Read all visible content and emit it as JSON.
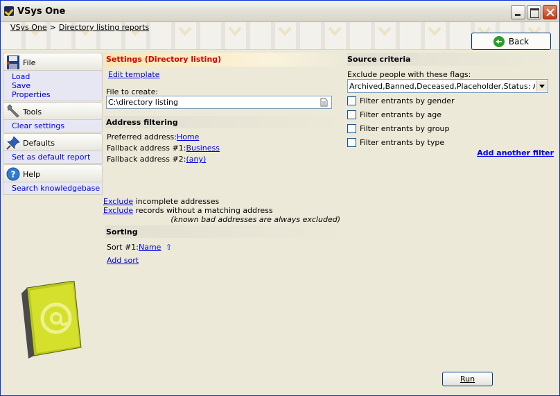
{
  "window": {
    "title": "VSys One"
  },
  "breadcrumb": {
    "root": "VSys One",
    "separator": ">",
    "current": "Directory listing reports"
  },
  "back_button": {
    "label": "Back"
  },
  "sidebar": {
    "sections": [
      {
        "title": "File",
        "icon": "floppy-disk-icon",
        "items": [
          "Load",
          "Save",
          "Properties"
        ]
      },
      {
        "title": "Tools",
        "icon": "wrench-icon",
        "items": [
          "Clear settings"
        ]
      },
      {
        "title": "Defaults",
        "icon": "pushpin-icon",
        "items": [
          "Set as default report"
        ]
      },
      {
        "title": "Help",
        "icon": "help-icon",
        "items": [
          "Search knowledgebase"
        ]
      }
    ]
  },
  "settings": {
    "title": "Settings (Directory listing)",
    "edit_template": "Edit template",
    "file_label": "File to create:",
    "file_value": "C:\\directory listing"
  },
  "address_filtering": {
    "title": "Address filtering",
    "preferred_label": "Preferred address:",
    "preferred_value": "Home",
    "fallback1_label": "Fallback address #1:",
    "fallback1_value": "Business",
    "fallback2_label": "Fallback address #2:",
    "fallback2_value": "(any)",
    "exclude1_link": "Exclude",
    "exclude1_text": " incomplete addresses",
    "exclude2_link": "Exclude",
    "exclude2_text": " records without a matching address",
    "note": "(known bad addresses are always excluded)"
  },
  "sorting": {
    "title": "Sorting",
    "sort1_label": "Sort #1:",
    "sort1_value": "Name",
    "sort1_dir": "⇧",
    "add_sort": "Add sort"
  },
  "source_criteria": {
    "title": "Source criteria",
    "exclude_flags_label": "Exclude people with these flags:",
    "flags_value": "Archived,Banned,Deceased,Placeholder,Status: Applica",
    "filters": [
      {
        "label": "Filter entrants by gender",
        "checked": false
      },
      {
        "label": "Filter entrants by age",
        "checked": false
      },
      {
        "label": "Filter entrants by group",
        "checked": false
      },
      {
        "label": "Filter entrants by type",
        "checked": false
      }
    ],
    "add_filter": "Add another filter"
  },
  "run_button": {
    "label": "Run"
  }
}
